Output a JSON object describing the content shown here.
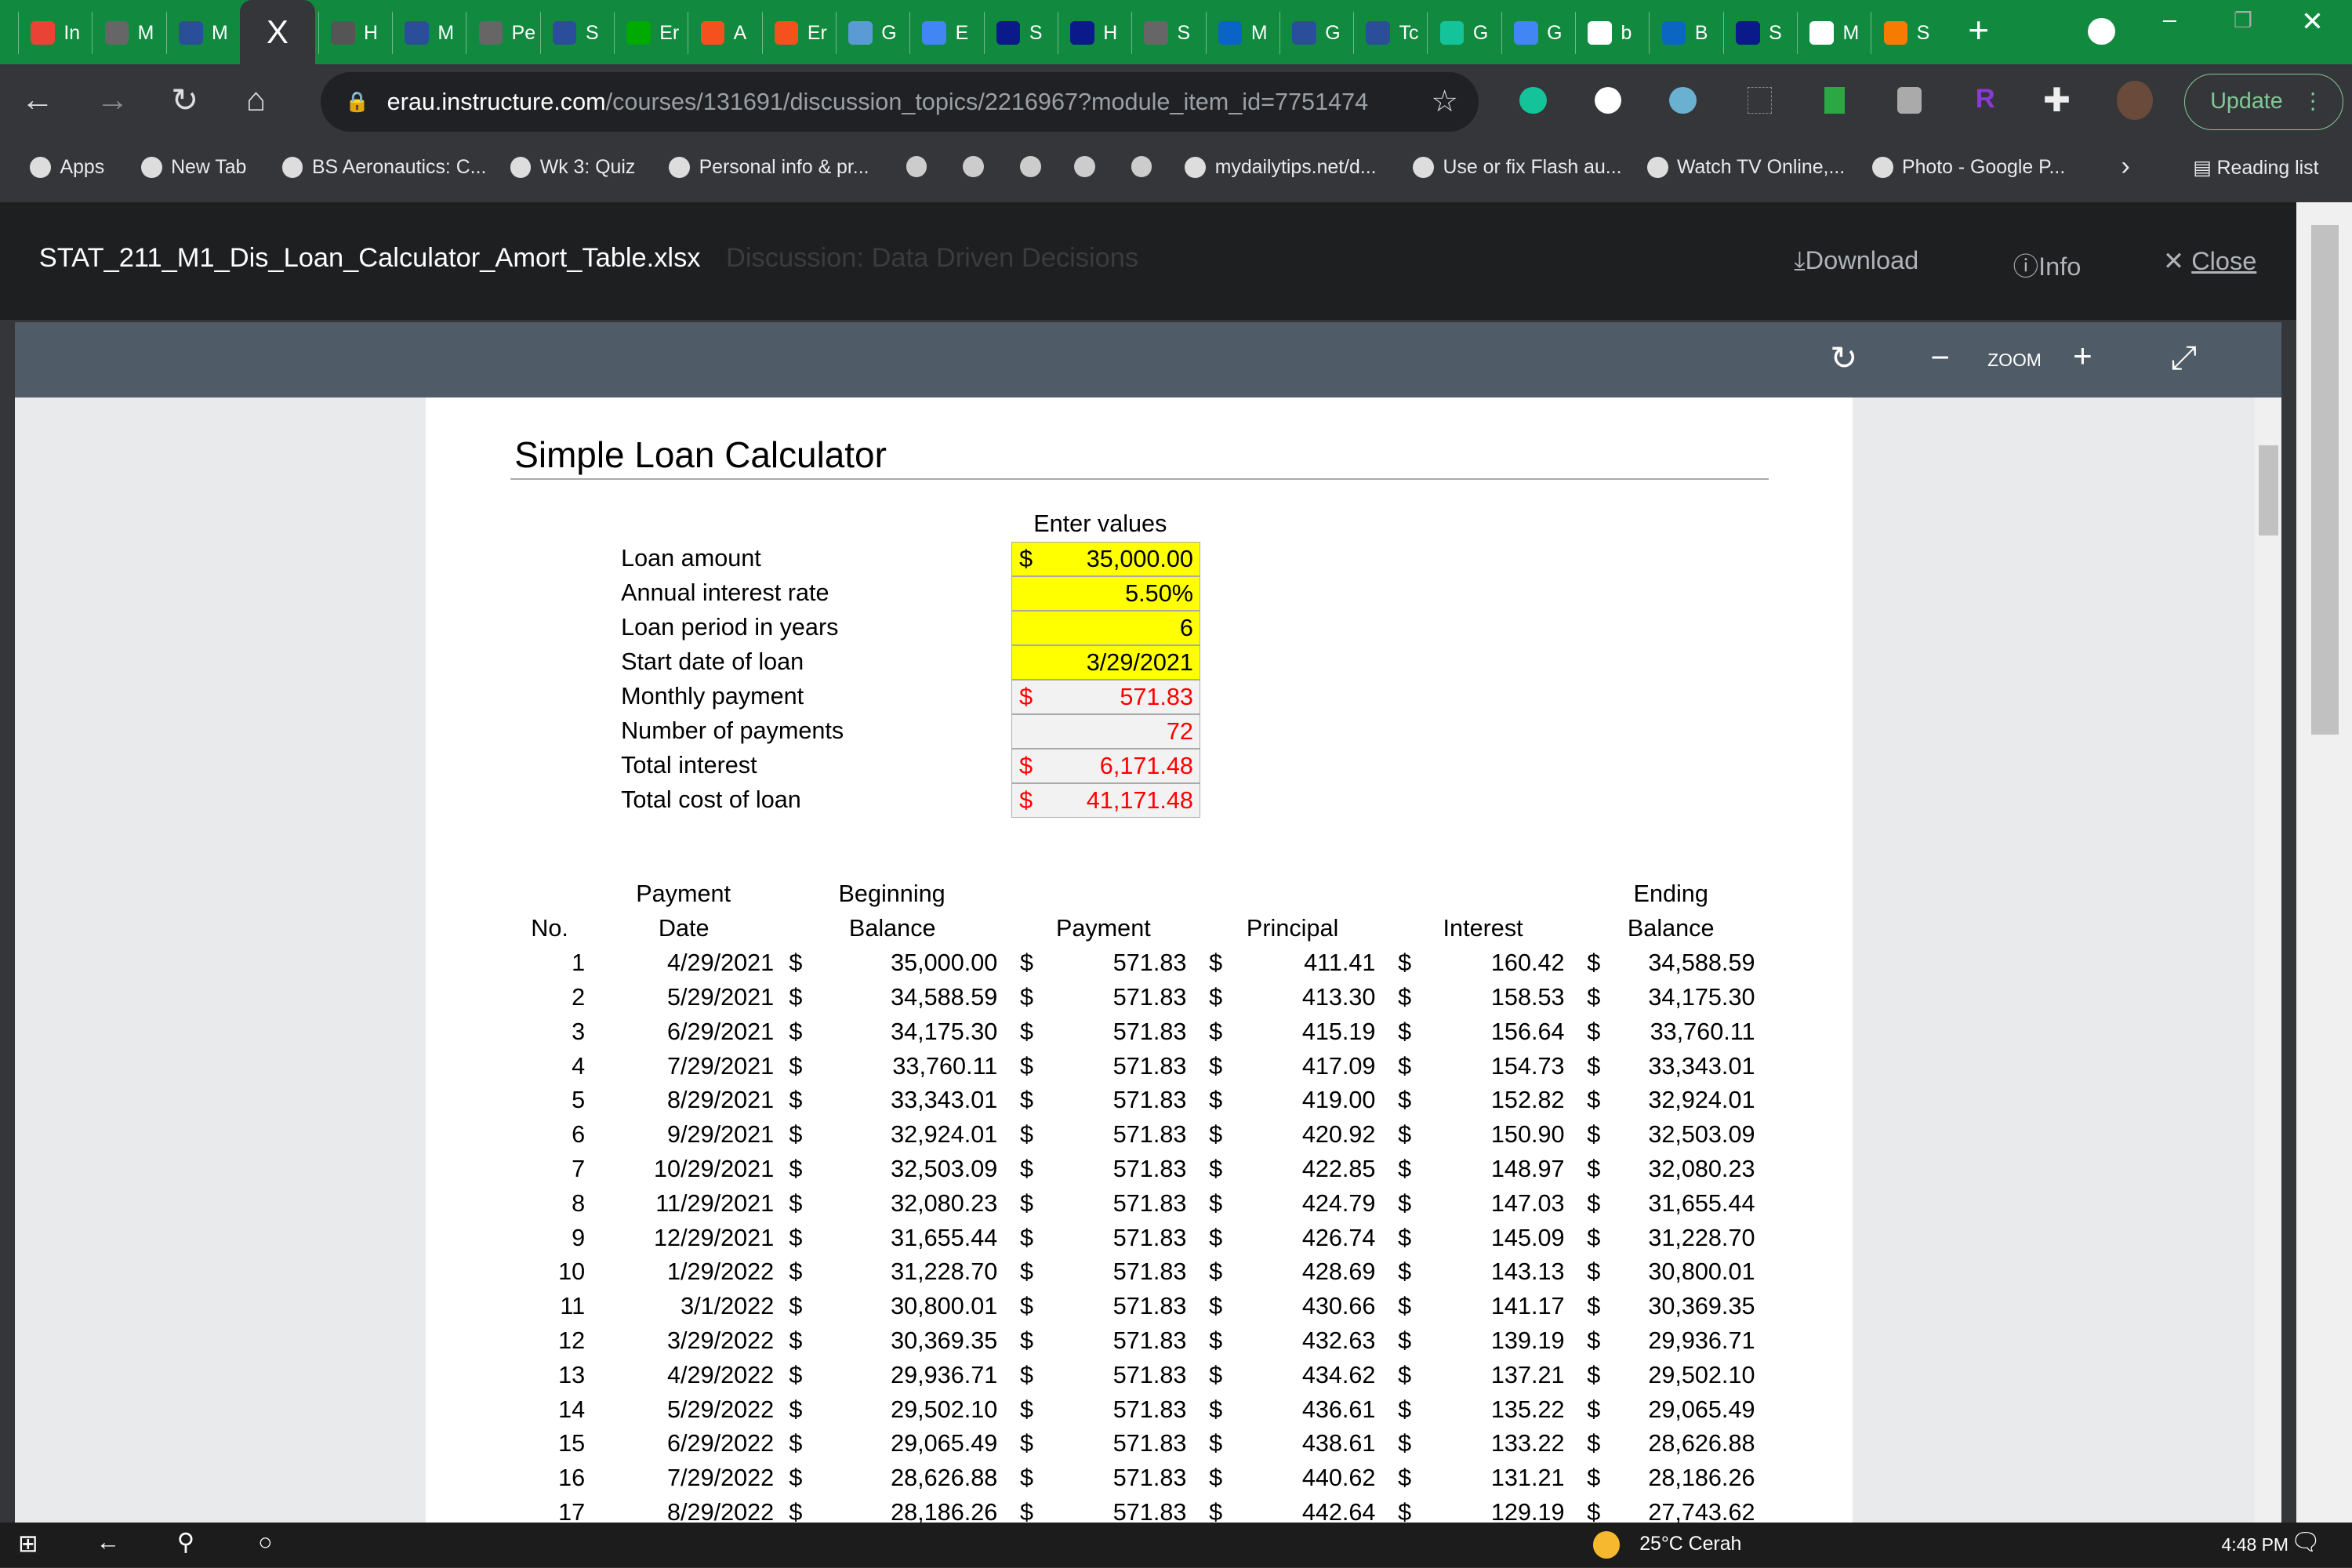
{
  "browser": {
    "tabs": [
      "In",
      "M",
      "M",
      "H",
      "M",
      "Pe",
      "S",
      "Er",
      "A",
      "Er",
      "G",
      "E",
      "S",
      "H",
      "S",
      "M",
      "G",
      "Tc",
      "G",
      "G",
      "b",
      "B",
      "S",
      "M",
      "S"
    ],
    "active_tab_close": "X",
    "url_host": "erau.instructure.com",
    "url_path": "/courses/131691/discussion_topics/2216967?module_item_id=7751474",
    "update_label": "Update",
    "bookmarks": [
      "Apps",
      "New Tab",
      "BS Aeronautics: C...",
      "Wk 3: Quiz",
      "Personal info & pr...",
      "mydailytips.net/d...",
      "Use or fix Flash au...",
      "Watch TV Online,...",
      "Photo - Google P..."
    ],
    "reading_list": "Reading list"
  },
  "viewer": {
    "filename": "STAT_211_M1_Dis_Loan_Calculator_Amort_Table.xlsx",
    "background_title": "Discussion: Data Driven Decisions",
    "download": "Download",
    "info": "Info",
    "close": "Close",
    "zoom": "ZOOM"
  },
  "sheet": {
    "title": "Simple Loan Calculator",
    "enter_values": "Enter values",
    "inputs": [
      {
        "label": "Loan amount",
        "cur": "$",
        "value": "35,000.00"
      },
      {
        "label": "Annual interest rate",
        "cur": "",
        "value": "5.50%"
      },
      {
        "label": "Loan period in years",
        "cur": "",
        "value": "6"
      },
      {
        "label": "Start date of loan",
        "cur": "",
        "value": "3/29/2021"
      }
    ],
    "outputs": [
      {
        "label": "Monthly payment",
        "cur": "$",
        "value": "571.83"
      },
      {
        "label": "Number of payments",
        "cur": "",
        "value": "72"
      },
      {
        "label": "Total interest",
        "cur": "$",
        "value": "6,171.48"
      },
      {
        "label": "Total cost of loan",
        "cur": "$",
        "value": "41,171.48"
      }
    ],
    "input_color": "#ffff00",
    "output_text_color": "#ff0000",
    "headers_top": [
      "",
      "Payment",
      "Beginning",
      "",
      "",
      "",
      "Ending"
    ],
    "headers": [
      "No.",
      "Date",
      "Balance",
      "Payment",
      "Principal",
      "Interest",
      "Balance"
    ],
    "rows": [
      [
        "1",
        "4/29/2021",
        "35,000.00",
        "571.83",
        "411.41",
        "160.42",
        "34,588.59"
      ],
      [
        "2",
        "5/29/2021",
        "34,588.59",
        "571.83",
        "413.30",
        "158.53",
        "34,175.30"
      ],
      [
        "3",
        "6/29/2021",
        "34,175.30",
        "571.83",
        "415.19",
        "156.64",
        "33,760.11"
      ],
      [
        "4",
        "7/29/2021",
        "33,760.11",
        "571.83",
        "417.09",
        "154.73",
        "33,343.01"
      ],
      [
        "5",
        "8/29/2021",
        "33,343.01",
        "571.83",
        "419.00",
        "152.82",
        "32,924.01"
      ],
      [
        "6",
        "9/29/2021",
        "32,924.01",
        "571.83",
        "420.92",
        "150.90",
        "32,503.09"
      ],
      [
        "7",
        "10/29/2021",
        "32,503.09",
        "571.83",
        "422.85",
        "148.97",
        "32,080.23"
      ],
      [
        "8",
        "11/29/2021",
        "32,080.23",
        "571.83",
        "424.79",
        "147.03",
        "31,655.44"
      ],
      [
        "9",
        "12/29/2021",
        "31,655.44",
        "571.83",
        "426.74",
        "145.09",
        "31,228.70"
      ],
      [
        "10",
        "1/29/2022",
        "31,228.70",
        "571.83",
        "428.69",
        "143.13",
        "30,800.01"
      ],
      [
        "11",
        "3/1/2022",
        "30,800.01",
        "571.83",
        "430.66",
        "141.17",
        "30,369.35"
      ],
      [
        "12",
        "3/29/2022",
        "30,369.35",
        "571.83",
        "432.63",
        "139.19",
        "29,936.71"
      ],
      [
        "13",
        "4/29/2022",
        "29,936.71",
        "571.83",
        "434.62",
        "137.21",
        "29,502.10"
      ],
      [
        "14",
        "5/29/2022",
        "29,502.10",
        "571.83",
        "436.61",
        "135.22",
        "29,065.49"
      ],
      [
        "15",
        "6/29/2022",
        "29,065.49",
        "571.83",
        "438.61",
        "133.22",
        "28,626.88"
      ],
      [
        "16",
        "7/29/2022",
        "28,626.88",
        "571.83",
        "440.62",
        "131.21",
        "28,186.26"
      ],
      [
        "17",
        "8/29/2022",
        "28,186.26",
        "571.83",
        "442.64",
        "129.19",
        "27,743.62"
      ]
    ],
    "currency": "$"
  },
  "taskbar": {
    "weather": "25°C  Cerah",
    "time": "4:48 PM"
  }
}
